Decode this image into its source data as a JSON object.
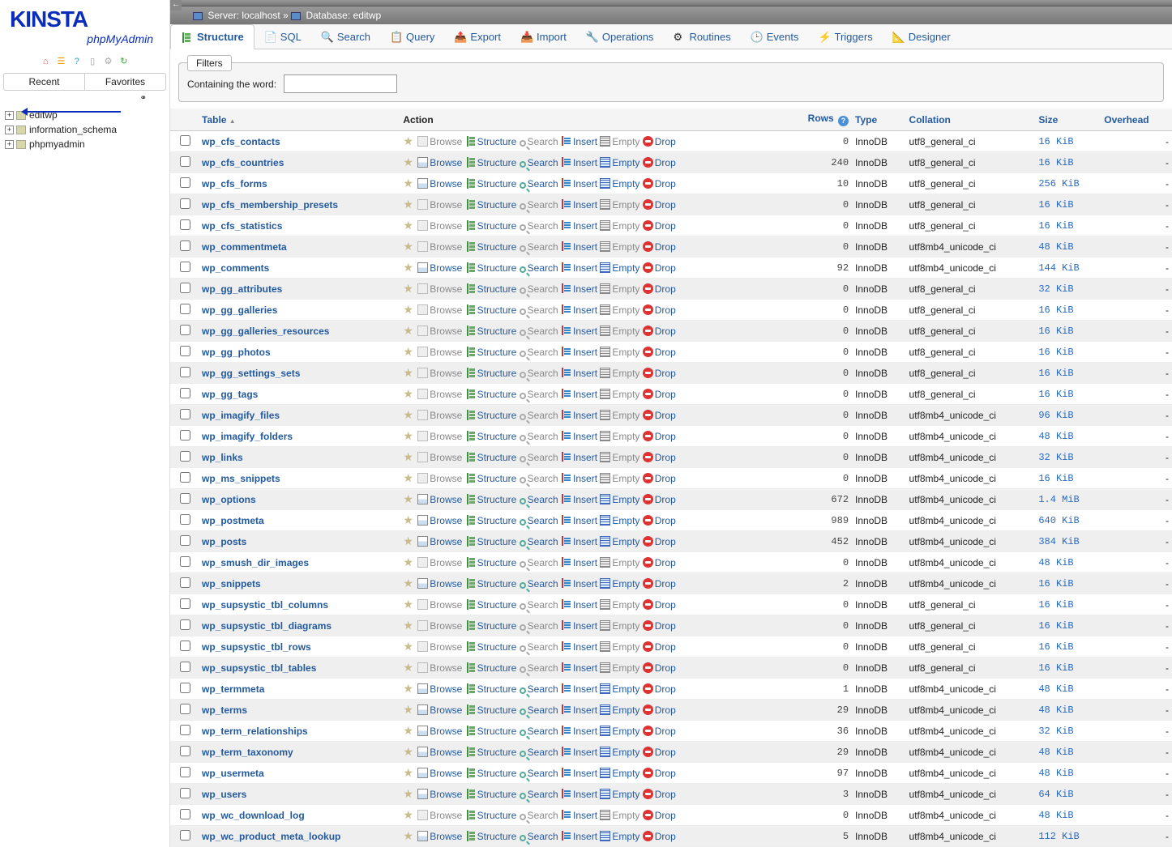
{
  "logo": {
    "main": "KINSTA",
    "sub": "phpMyAdmin"
  },
  "sidebar": {
    "tabs": [
      "Recent",
      "Favorites"
    ],
    "databases": [
      "editwp",
      "information_schema",
      "phpmyadmin"
    ]
  },
  "breadcrumb": {
    "server_lbl": "Server:",
    "server": "localhost",
    "sep": "»",
    "db_lbl": "Database:",
    "db": "editwp"
  },
  "menuTabs": [
    "Structure",
    "SQL",
    "Search",
    "Query",
    "Export",
    "Import",
    "Operations",
    "Routines",
    "Events",
    "Triggers",
    "Designer"
  ],
  "filters": {
    "legend": "Filters",
    "label": "Containing the word:",
    "value": ""
  },
  "columns": {
    "table": "Table",
    "action": "Action",
    "rows": "Rows",
    "type": "Type",
    "collation": "Collation",
    "size": "Size",
    "overhead": "Overhead"
  },
  "actions": {
    "browse": "Browse",
    "structure": "Structure",
    "search": "Search",
    "insert": "Insert",
    "empty": "Empty",
    "drop": "Drop"
  },
  "tables": [
    {
      "n": "wp_cfs_contacts",
      "r": 0,
      "t": "InnoDB",
      "c": "utf8_general_ci",
      "s": "16 KiB",
      "e": 0
    },
    {
      "n": "wp_cfs_countries",
      "r": 240,
      "t": "InnoDB",
      "c": "utf8_general_ci",
      "s": "16 KiB",
      "e": 0
    },
    {
      "n": "wp_cfs_forms",
      "r": 10,
      "t": "InnoDB",
      "c": "utf8_general_ci",
      "s": "256 KiB",
      "e": 0
    },
    {
      "n": "wp_cfs_membership_presets",
      "r": 0,
      "t": "InnoDB",
      "c": "utf8_general_ci",
      "s": "16 KiB",
      "e": 0
    },
    {
      "n": "wp_cfs_statistics",
      "r": 0,
      "t": "InnoDB",
      "c": "utf8_general_ci",
      "s": "16 KiB",
      "e": 0
    },
    {
      "n": "wp_commentmeta",
      "r": 0,
      "t": "InnoDB",
      "c": "utf8mb4_unicode_ci",
      "s": "48 KiB",
      "e": 0
    },
    {
      "n": "wp_comments",
      "r": 92,
      "t": "InnoDB",
      "c": "utf8mb4_unicode_ci",
      "s": "144 KiB",
      "e": 0
    },
    {
      "n": "wp_gg_attributes",
      "r": 0,
      "t": "InnoDB",
      "c": "utf8_general_ci",
      "s": "32 KiB",
      "e": 0
    },
    {
      "n": "wp_gg_galleries",
      "r": 0,
      "t": "InnoDB",
      "c": "utf8_general_ci",
      "s": "16 KiB",
      "e": 0
    },
    {
      "n": "wp_gg_galleries_resources",
      "r": 0,
      "t": "InnoDB",
      "c": "utf8_general_ci",
      "s": "16 KiB",
      "e": 0
    },
    {
      "n": "wp_gg_photos",
      "r": 0,
      "t": "InnoDB",
      "c": "utf8_general_ci",
      "s": "16 KiB",
      "e": 0
    },
    {
      "n": "wp_gg_settings_sets",
      "r": 0,
      "t": "InnoDB",
      "c": "utf8_general_ci",
      "s": "16 KiB",
      "e": 0
    },
    {
      "n": "wp_gg_tags",
      "r": 0,
      "t": "InnoDB",
      "c": "utf8_general_ci",
      "s": "16 KiB",
      "e": 0
    },
    {
      "n": "wp_imagify_files",
      "r": 0,
      "t": "InnoDB",
      "c": "utf8mb4_unicode_ci",
      "s": "96 KiB",
      "e": 0
    },
    {
      "n": "wp_imagify_folders",
      "r": 0,
      "t": "InnoDB",
      "c": "utf8mb4_unicode_ci",
      "s": "48 KiB",
      "e": 0
    },
    {
      "n": "wp_links",
      "r": 0,
      "t": "InnoDB",
      "c": "utf8mb4_unicode_ci",
      "s": "32 KiB",
      "e": 0
    },
    {
      "n": "wp_ms_snippets",
      "r": 0,
      "t": "InnoDB",
      "c": "utf8mb4_unicode_ci",
      "s": "16 KiB",
      "e": 0
    },
    {
      "n": "wp_options",
      "r": 672,
      "t": "InnoDB",
      "c": "utf8mb4_unicode_ci",
      "s": "1.4 MiB",
      "e": 0
    },
    {
      "n": "wp_postmeta",
      "r": 989,
      "t": "InnoDB",
      "c": "utf8mb4_unicode_ci",
      "s": "640 KiB",
      "e": 0
    },
    {
      "n": "wp_posts",
      "r": 452,
      "t": "InnoDB",
      "c": "utf8mb4_unicode_ci",
      "s": "384 KiB",
      "e": 0
    },
    {
      "n": "wp_smush_dir_images",
      "r": 0,
      "t": "InnoDB",
      "c": "utf8mb4_unicode_ci",
      "s": "48 KiB",
      "e": 0
    },
    {
      "n": "wp_snippets",
      "r": 2,
      "t": "InnoDB",
      "c": "utf8mb4_unicode_ci",
      "s": "16 KiB",
      "e": 0
    },
    {
      "n": "wp_supsystic_tbl_columns",
      "r": 0,
      "t": "InnoDB",
      "c": "utf8_general_ci",
      "s": "16 KiB",
      "e": 0
    },
    {
      "n": "wp_supsystic_tbl_diagrams",
      "r": 0,
      "t": "InnoDB",
      "c": "utf8_general_ci",
      "s": "16 KiB",
      "e": 0
    },
    {
      "n": "wp_supsystic_tbl_rows",
      "r": 0,
      "t": "InnoDB",
      "c": "utf8_general_ci",
      "s": "16 KiB",
      "e": 0
    },
    {
      "n": "wp_supsystic_tbl_tables",
      "r": 0,
      "t": "InnoDB",
      "c": "utf8_general_ci",
      "s": "16 KiB",
      "e": 0
    },
    {
      "n": "wp_termmeta",
      "r": 1,
      "t": "InnoDB",
      "c": "utf8mb4_unicode_ci",
      "s": "48 KiB",
      "e": 0
    },
    {
      "n": "wp_terms",
      "r": 29,
      "t": "InnoDB",
      "c": "utf8mb4_unicode_ci",
      "s": "48 KiB",
      "e": 0
    },
    {
      "n": "wp_term_relationships",
      "r": 36,
      "t": "InnoDB",
      "c": "utf8mb4_unicode_ci",
      "s": "32 KiB",
      "e": 0
    },
    {
      "n": "wp_term_taxonomy",
      "r": 29,
      "t": "InnoDB",
      "c": "utf8mb4_unicode_ci",
      "s": "48 KiB",
      "e": 0
    },
    {
      "n": "wp_usermeta",
      "r": 97,
      "t": "InnoDB",
      "c": "utf8mb4_unicode_ci",
      "s": "48 KiB",
      "e": 0
    },
    {
      "n": "wp_users",
      "r": 3,
      "t": "InnoDB",
      "c": "utf8mb4_unicode_ci",
      "s": "64 KiB",
      "e": 0
    },
    {
      "n": "wp_wc_download_log",
      "r": 0,
      "t": "InnoDB",
      "c": "utf8mb4_unicode_ci",
      "s": "48 KiB",
      "e": 0
    },
    {
      "n": "wp_wc_product_meta_lookup",
      "r": 5,
      "t": "InnoDB",
      "c": "utf8mb4_unicode_ci",
      "s": "112 KiB",
      "e": 0
    }
  ]
}
